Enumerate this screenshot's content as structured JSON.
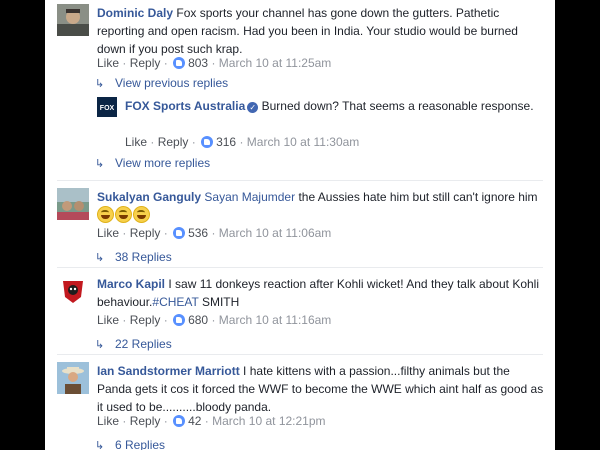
{
  "comments": [
    {
      "name": "Dominic Daly",
      "text": "Fox sports your channel has gone down the gutters. Pathetic reporting and open racism. Had you been in India. Your studio would be burned down if you post such krap.",
      "like_label": "Like",
      "reply_label": "Reply",
      "likes": "803",
      "time": "March 10 at 11:25am",
      "previous_replies_label": "View previous replies",
      "more_replies_label": "View more replies",
      "reply": {
        "name": "FOX Sports Australia",
        "avatar_text": "FOX",
        "text": "Burned down? That seems a reasonable response.",
        "like_label": "Like",
        "reply_label": "Reply",
        "likes": "316",
        "time": "March 10 at 11:30am"
      }
    },
    {
      "name": "Sukalyan Ganguly",
      "mention": "Sayan Majumder",
      "text": "the Aussies hate him but still can't ignore him",
      "like_label": "Like",
      "reply_label": "Reply",
      "likes": "536",
      "time": "March 10 at 11:06am",
      "replies_label": "38 Replies"
    },
    {
      "name": "Marco Kapil",
      "text": "I saw 11 donkeys reaction after Kohli wicket! And they talk about Kohli behaviour.",
      "hashtag": "#CHEAT",
      "text_after": " SMITH",
      "like_label": "Like",
      "reply_label": "Reply",
      "likes": "680",
      "time": "March 10 at 11:16am",
      "replies_label": "22 Replies"
    },
    {
      "name": "Ian Sandstormer Marriott",
      "text": "I hate kittens with a passion...filthy animals but the Panda gets it cos it forced the WWF to become the WWE which aint half as good as it used to be..........bloody panda.",
      "like_label": "Like",
      "reply_label": "Reply",
      "likes": "42",
      "time": "March 10 at 12:21pm",
      "replies_label": "6 Replies"
    }
  ],
  "colors": {
    "name_link": "#365899",
    "like_badge": "#5890ff",
    "meta": "#90949c"
  }
}
